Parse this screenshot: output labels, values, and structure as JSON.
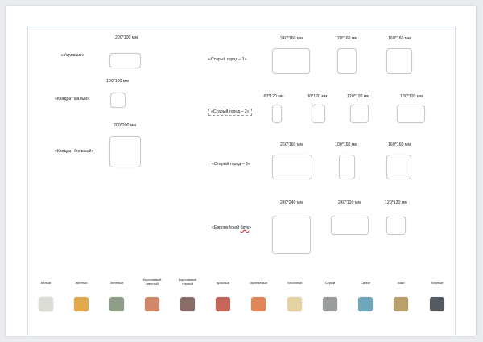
{
  "left_products": [
    {
      "name": "«Кирпичик»",
      "size": "200*100 мм"
    },
    {
      "name": "«Квадрат малый»",
      "size": "100*100 мм"
    },
    {
      "name": "«Квадрат большой»",
      "size": "200*200 мм"
    }
  ],
  "right_products": [
    {
      "name": "«Старый город – 1»",
      "sizes": [
        "240*160 мм",
        "120*160 мм",
        "160*160 мм"
      ]
    },
    {
      "name": "«Старый город – 2»",
      "sizes": [
        "60*120 мм",
        "90*120 мм",
        "120*120 мм",
        "180*120 мм"
      ]
    },
    {
      "name": "«Старый город – 3»",
      "sizes": [
        "260*160 мм",
        "100*160 мм",
        "160*160 мм"
      ]
    },
    {
      "name": "«Европейский брук»",
      "name_prefix": "«Европейский ",
      "name_word": "брук",
      "name_suffix": "»",
      "sizes": [
        "240*240 мм",
        "240*120 мм",
        "120*120 мм"
      ]
    }
  ],
  "colors": [
    {
      "label": "Белый",
      "hex": "#dcdcd6"
    },
    {
      "label": "Желтый",
      "hex": "#e1a84c"
    },
    {
      "label": "Зеленый",
      "hex": "#8e9e88"
    },
    {
      "label": "Коричневый светлый",
      "hex": "#d1876a"
    },
    {
      "label": "Коричневый темный",
      "hex": "#8a6d69"
    },
    {
      "label": "Красный",
      "hex": "#c4675a"
    },
    {
      "label": "Оранжевый",
      "hex": "#e18658"
    },
    {
      "label": "Песочный",
      "hex": "#e6d3a4"
    },
    {
      "label": "Серый",
      "hex": "#9a9c9e"
    },
    {
      "label": "Синий",
      "hex": "#6fa7bd"
    },
    {
      "label": "Хаки",
      "hex": "#b8a06a"
    },
    {
      "label": "Черный",
      "hex": "#555a60"
    }
  ]
}
